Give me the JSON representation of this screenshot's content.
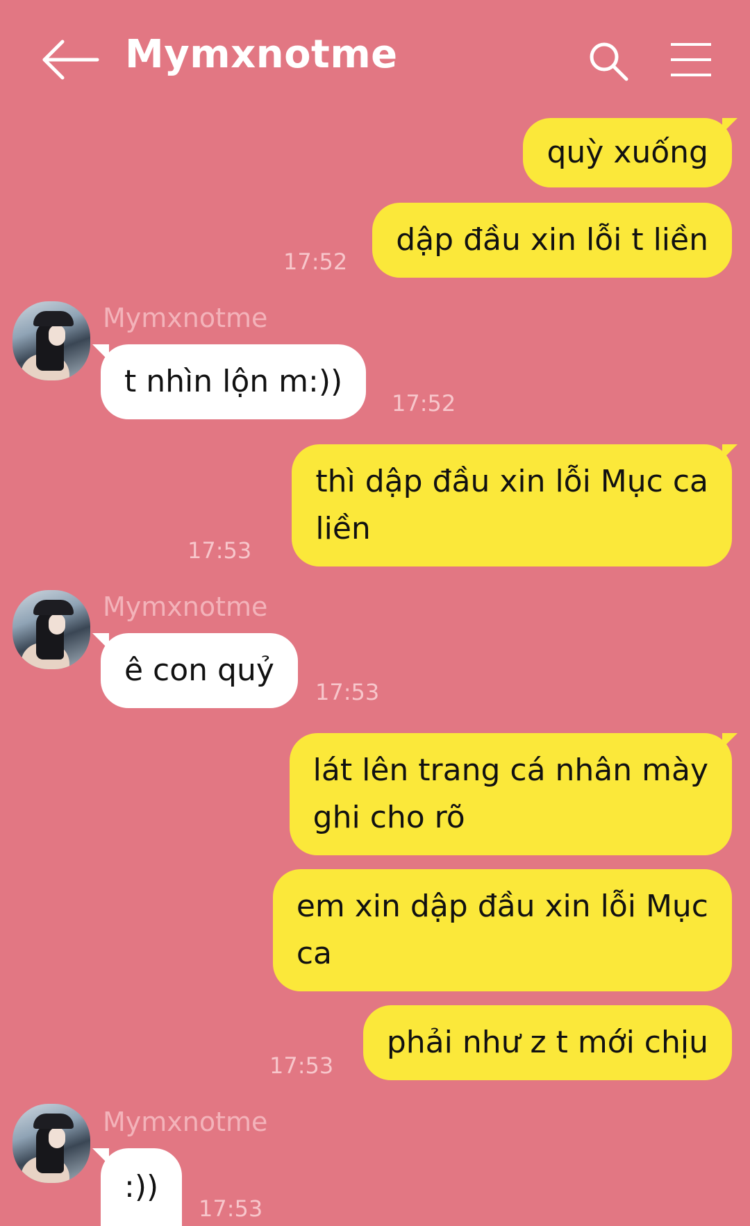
{
  "header": {
    "title": "Mymxnotme",
    "back_icon": "arrow-left-icon",
    "search_icon": "search-icon",
    "menu_icon": "hamburger-menu-icon"
  },
  "colors": {
    "background": "#e27783",
    "my_bubble": "#fbe83a",
    "their_bubble": "#ffffff"
  },
  "messages": [
    {
      "from": "me",
      "lines": [
        "quỳ xuống"
      ],
      "time": ""
    },
    {
      "from": "me",
      "lines": [
        "dập đầu xin lỗi t liền"
      ],
      "time": "17:52"
    },
    {
      "from": "them",
      "sender": "Mymxnotme",
      "lines": [
        "t nhìn lộn m:))"
      ],
      "time": "17:52"
    },
    {
      "from": "me",
      "lines": [
        "thì dập đầu xin lỗi Mục ca",
        "liền"
      ],
      "time": "17:53"
    },
    {
      "from": "them",
      "sender": "Mymxnotme",
      "lines": [
        "ê con quỷ"
      ],
      "time": "17:53"
    },
    {
      "from": "me",
      "lines": [
        "lát lên trang cá nhân mày",
        "ghi cho rõ"
      ],
      "time": ""
    },
    {
      "from": "me",
      "lines": [
        "em xin dập đầu xin lỗi Mục",
        "ca"
      ],
      "time": ""
    },
    {
      "from": "me",
      "lines": [
        "phải như z t mới chịu"
      ],
      "time": "17:53"
    },
    {
      "from": "them",
      "sender": "Mymxnotme",
      "lines": [
        ":))"
      ],
      "time": "17:53"
    }
  ]
}
